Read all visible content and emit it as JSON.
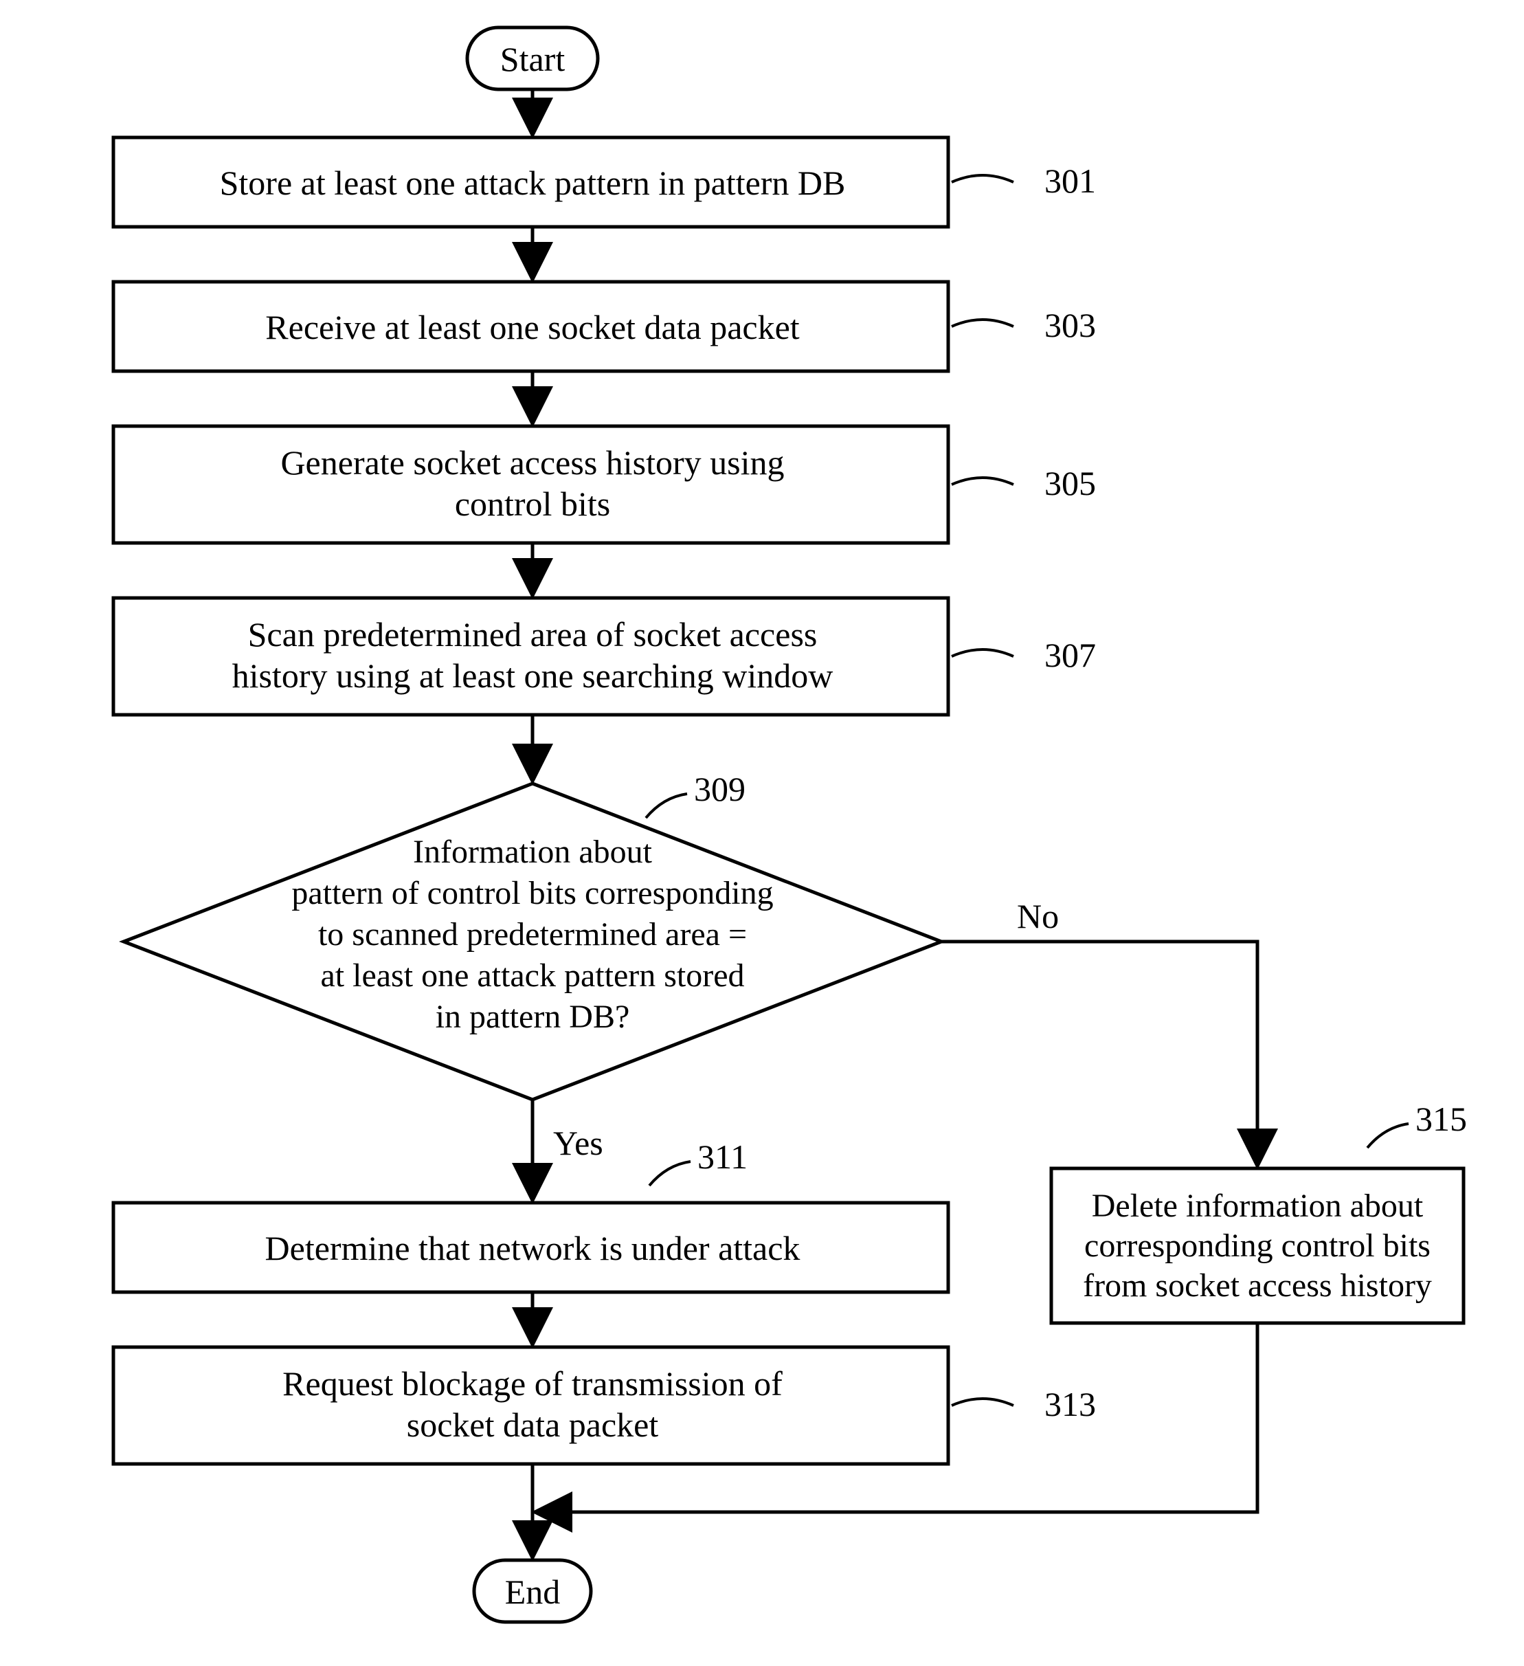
{
  "flowchart": {
    "start": "Start",
    "end": "End",
    "steps": [
      {
        "id": "301",
        "text": "Store at least one attack pattern in pattern DB",
        "ref": "301"
      },
      {
        "id": "303",
        "text": "Receive at least one socket data packet",
        "ref": "303"
      },
      {
        "id": "305",
        "text_line1": "Generate socket access history using",
        "text_line2": "control bits",
        "ref": "305"
      },
      {
        "id": "307",
        "text_line1": "Scan predetermined area of socket access",
        "text_line2": "history using at least one searching window",
        "ref": "307"
      }
    ],
    "decision": {
      "ref": "309",
      "line1": "Information about",
      "line2": "pattern of control bits corresponding",
      "line3": "to scanned predetermined area =",
      "line4": "at least one attack pattern stored",
      "line5": "in pattern DB?",
      "yes": "Yes",
      "no": "No"
    },
    "step311": {
      "text": "Determine that network is under attack",
      "ref": "311"
    },
    "step313": {
      "text_line1": "Request blockage of transmission of",
      "text_line2": "socket data packet",
      "ref": "313"
    },
    "step315": {
      "text_line1": "Delete information about",
      "text_line2": "corresponding control bits",
      "text_line3": "from socket access history",
      "ref": "315"
    }
  }
}
